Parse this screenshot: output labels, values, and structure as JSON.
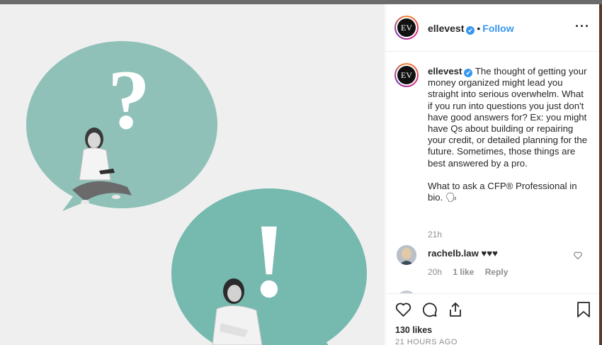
{
  "post": {
    "username": "ellevest",
    "verified_mark": "✔",
    "dot": "•",
    "follow_label": "Follow",
    "more_label": "···",
    "avatar_text": "EV"
  },
  "caption": {
    "username": "ellevest",
    "text_p1": "The thought of getting your money organized might lead you straight into serious overwhelm. What if you run into questions you just don't have good answers for? Ex: you might have Qs about building or repairing your credit, or detailed planning for the future. Sometimes, those things are best answered by a pro.",
    "text_p2": "What to ask a CFP® Professional in bio. 🗣",
    "time": "21h"
  },
  "comments": [
    {
      "username": "rachelb.law",
      "text": "♥♥♥",
      "time": "20h",
      "likes": "1 like",
      "reply_label": "Reply"
    }
  ],
  "actions": {
    "likes": "130 likes",
    "posted_ago": "21 HOURS AGO"
  },
  "image": {
    "question_mark": "?",
    "exclamation_mark": "!",
    "bubble_color": "#8fc1b8",
    "bubble_color_2": "#75b9af"
  },
  "colors": {
    "link": "#3897f0",
    "text": "#262626",
    "muted": "#8e8e8e"
  },
  "icons": [
    "heart-icon",
    "comment-icon",
    "share-icon",
    "bookmark-icon",
    "more-icon",
    "verified-icon",
    "small-heart-icon"
  ]
}
